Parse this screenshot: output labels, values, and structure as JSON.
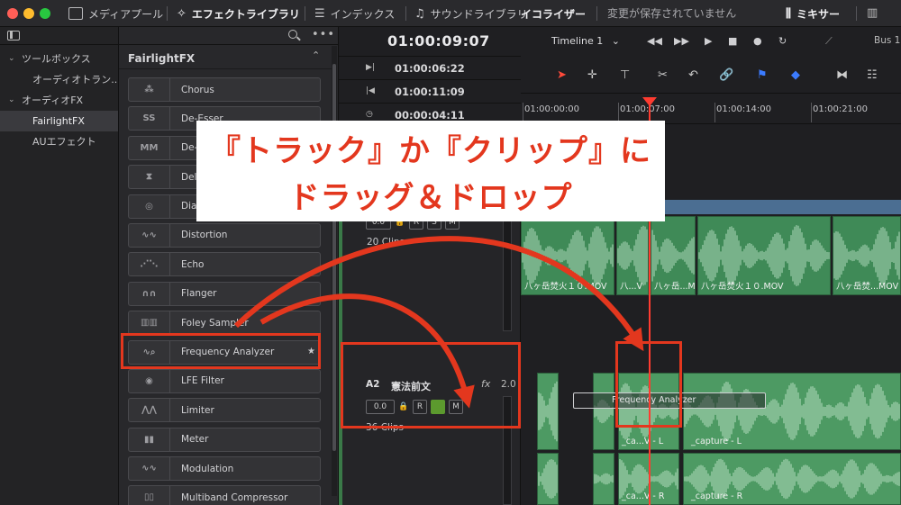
{
  "topbar": {
    "media_pool": "メディアプール",
    "effects_library": "エフェクトライブラリ",
    "index": "インデックス",
    "sound_library": "サウンドライブラリ",
    "equalizer": "イコライザー",
    "status": "変更が保存されていません",
    "mixer": "ミキサー"
  },
  "tree": {
    "items": [
      {
        "label": "ツールボックス",
        "level": 0
      },
      {
        "label": "オーディオトラン...",
        "level": 1
      },
      {
        "label": "オーディオFX",
        "level": 0
      },
      {
        "label": "FairlightFX",
        "level": 1,
        "selected": true
      },
      {
        "label": "AUエフェクト",
        "level": 1
      }
    ]
  },
  "fx": {
    "header": "FairlightFX",
    "items": [
      {
        "name": "Chorus",
        "thumb": "chorus-icon",
        "glyph": "⁂"
      },
      {
        "name": "De-Esser",
        "thumb": "deesser-icon",
        "glyph": "SS"
      },
      {
        "name": "De-Hummer",
        "thumb": "dehummer-icon",
        "glyph": "MM"
      },
      {
        "name": "Delay",
        "thumb": "delay-icon",
        "glyph": "⧗"
      },
      {
        "name": "Dialogue Processor",
        "thumb": "dialogue-icon",
        "glyph": "◎"
      },
      {
        "name": "Distortion",
        "thumb": "distortion-icon",
        "glyph": "∿∿"
      },
      {
        "name": "Echo",
        "thumb": "echo-icon",
        "glyph": "⋰⋱"
      },
      {
        "name": "Flanger",
        "thumb": "flanger-icon",
        "glyph": "∩∩"
      },
      {
        "name": "Foley Sampler",
        "thumb": "foley-icon",
        "glyph": "▥▥"
      },
      {
        "name": "Frequency Analyzer",
        "thumb": "frequency-analyzer-icon",
        "glyph": "∿⌕",
        "starred": true
      },
      {
        "name": "LFE Filter",
        "thumb": "lfe-icon",
        "glyph": "◉"
      },
      {
        "name": "Limiter",
        "thumb": "limiter-icon",
        "glyph": "⋀⋀"
      },
      {
        "name": "Meter",
        "thumb": "meter-icon",
        "glyph": "▮▮"
      },
      {
        "name": "Modulation",
        "thumb": "modulation-icon",
        "glyph": "∿∿"
      },
      {
        "name": "Multiband Compressor",
        "thumb": "multiband-icon",
        "glyph": "▯▯"
      }
    ]
  },
  "timeline": {
    "timecode": "01:00:09:07",
    "name": "Timeline 1",
    "bus": "Bus 1",
    "in_tc": "01:00:06:22",
    "out_tc": "01:00:11:09",
    "dur_tc": "00:00:04:11",
    "ruler": [
      "01:00:00:00",
      "01:00:07:00",
      "01:00:14:00",
      "01:00:21:00"
    ]
  },
  "tracks": {
    "a1": {
      "volume": "0.0",
      "clips": "20 Clips",
      "clip_labels": [
        "八ヶ岳焚火１０.MOV",
        "八...V",
        "八ヶ岳...MOV",
        "八ヶ岳焚火１０.MOV",
        "八ヶ岳焚...MOV"
      ]
    },
    "a2": {
      "code": "A2",
      "name": "憲法前文",
      "fx": "fx",
      "level": "2.0",
      "volume": "0.0",
      "clips": "36 Clips",
      "clip_label_l": "_capture - L",
      "clip_label_r": "_capture - R",
      "clip_short_l": "_ca...V - L",
      "clip_short_r": "_ca...V - R"
    },
    "rsm": [
      "R",
      "S",
      "M"
    ],
    "fx_tag": "Frequency Analyzer"
  },
  "callout": {
    "line1": "『トラック』か『クリップ』に",
    "line2": "ドラッグ＆ドロップ"
  },
  "colors": {
    "accent": "#e3371e",
    "clip": "#3f8a57",
    "playhead": "#ff3b30"
  }
}
